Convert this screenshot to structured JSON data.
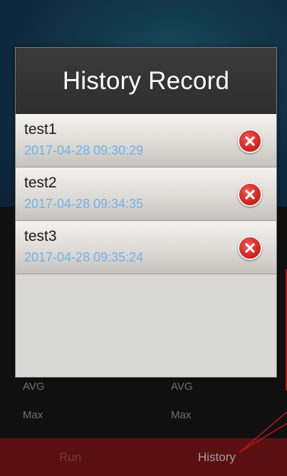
{
  "background": {
    "labels": [
      {
        "text": "AVG",
        "col": 1
      },
      {
        "text": "AVG",
        "col": 2
      },
      {
        "text": "Max",
        "col": 1
      },
      {
        "text": "Max",
        "col": 2
      }
    ]
  },
  "bottom_bar": {
    "run_label": "Run",
    "history_label": "History"
  },
  "dialog": {
    "title": "History Record",
    "records": [
      {
        "name": "test1",
        "time": "2017-04-28 09:30:29"
      },
      {
        "name": "test2",
        "time": "2017-04-28 09:34:35"
      },
      {
        "name": "test3",
        "time": "2017-04-28 09:35:24"
      }
    ]
  },
  "colors": {
    "timestamp": "#6fb3ea",
    "bottom_bar": "#6e1414",
    "delete_button": "#d42a25"
  },
  "icons": {
    "delete": "close-circle-icon"
  }
}
